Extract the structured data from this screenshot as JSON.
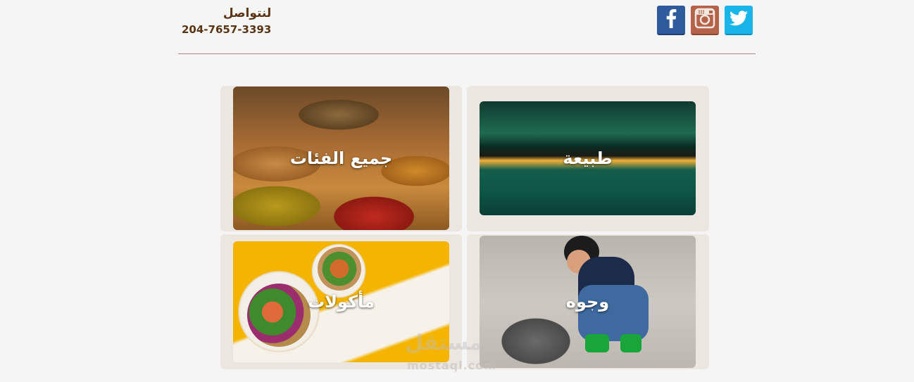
{
  "header": {
    "contact_title": "لنتواصل",
    "phone": "204-7657-3393",
    "social": [
      {
        "name": "facebook",
        "icon": "facebook-icon",
        "color": "#2f5a9b"
      },
      {
        "name": "instagram",
        "icon": "instagram-icon",
        "color": "#b4634a"
      },
      {
        "name": "twitter",
        "icon": "twitter-icon",
        "color": "#19b5e8"
      }
    ]
  },
  "categories": {
    "all": "جميع الفئات",
    "nature": "طبيعة",
    "food": "مأكولات",
    "faces": "وجوه"
  },
  "watermark": {
    "arabic": "مستقل",
    "latin": "mostaql.com"
  },
  "colors": {
    "accent_text": "#5a3413",
    "divider": "#b08d7a",
    "card_bg": "#ece6e1"
  }
}
